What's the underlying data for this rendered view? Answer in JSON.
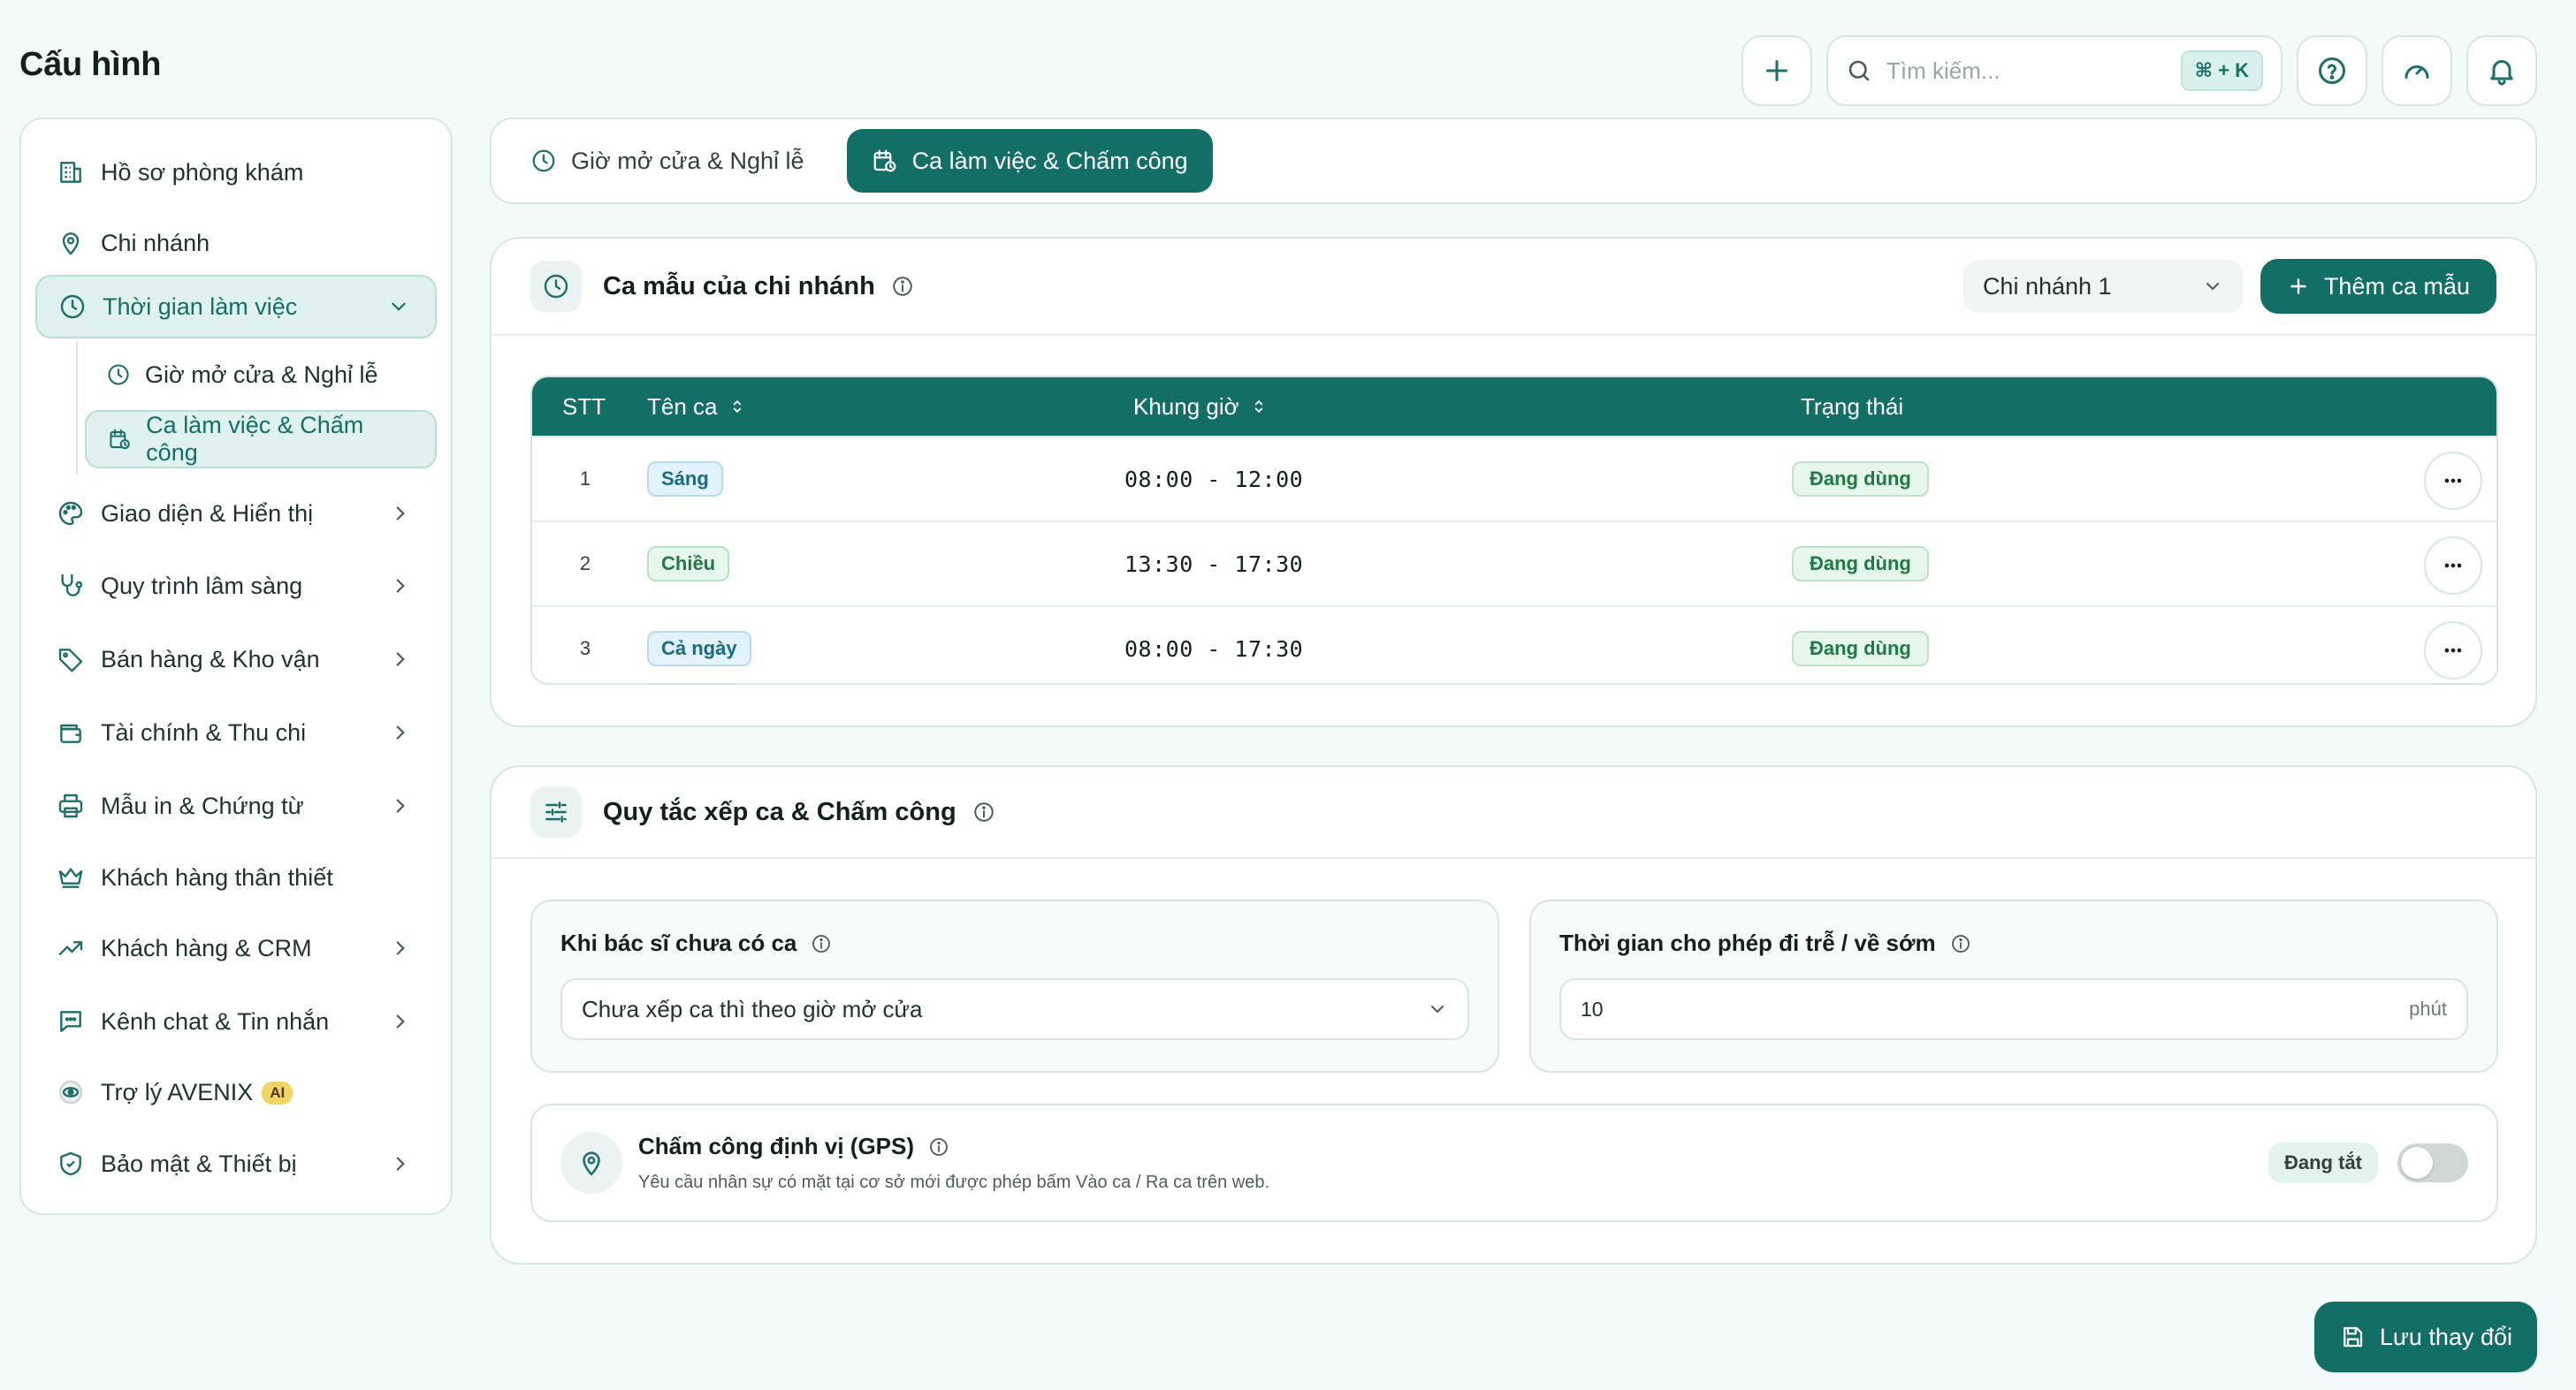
{
  "page": {
    "title": "Cấu hình"
  },
  "topbar": {
    "search_placeholder": "Tìm kiếm...",
    "shortcut": "⌘ + K"
  },
  "sidebar": {
    "items": [
      {
        "label": "Hồ sơ phòng khám",
        "icon": "building-icon"
      },
      {
        "label": "Chi nhánh",
        "icon": "map-pin-icon"
      },
      {
        "label": "Thời gian làm việc",
        "icon": "clock-icon"
      },
      {
        "label": "Giao diện & Hiển thị",
        "icon": "palette-icon"
      },
      {
        "label": "Quy trình lâm sàng",
        "icon": "stethoscope-icon"
      },
      {
        "label": "Bán hàng & Kho vận",
        "icon": "tag-icon"
      },
      {
        "label": "Tài chính & Thu chi",
        "icon": "wallet-icon"
      },
      {
        "label": "Mẫu in & Chứng từ",
        "icon": "printer-icon"
      },
      {
        "label": "Khách hàng thân thiết",
        "icon": "crown-icon"
      },
      {
        "label": "Khách hàng & CRM",
        "icon": "trending-up-icon"
      },
      {
        "label": "Kênh chat & Tin nhắn",
        "icon": "message-icon"
      },
      {
        "label": "Trợ lý AVENIX",
        "icon": "eye-icon",
        "badge": "AI"
      },
      {
        "label": "Bảo mật & Thiết bị",
        "icon": "shield-icon"
      }
    ],
    "subitems": [
      {
        "label": "Giờ mở cửa & Nghỉ lễ"
      },
      {
        "label": "Ca làm việc & Chấm công"
      }
    ]
  },
  "tabs": [
    {
      "label": "Giờ mở cửa & Nghỉ lễ"
    },
    {
      "label": "Ca làm việc & Chấm công"
    }
  ],
  "shift_templates": {
    "title": "Ca mẫu của chi nhánh",
    "branch": "Chi nhánh 1",
    "add_label": "Thêm ca mẫu",
    "columns": [
      "STT",
      "Tên ca",
      "Khung giờ",
      "Trạng thái"
    ],
    "rows": [
      {
        "stt": "1",
        "name": "Sáng",
        "time": "08:00 - 12:00",
        "status": "Đang dùng"
      },
      {
        "stt": "2",
        "name": "Chiều",
        "time": "13:30 - 17:30",
        "status": "Đang dùng"
      },
      {
        "stt": "3",
        "name": "Cả ngày",
        "time": "08:00 - 17:30",
        "status": "Đang dùng"
      }
    ]
  },
  "rules": {
    "title": "Quy tắc xếp ca & Chấm công",
    "no_shift": {
      "label": "Khi bác sĩ chưa có ca",
      "value": "Chưa xếp ca thì theo giờ mở cửa"
    },
    "tolerance": {
      "label": "Thời gian cho phép đi trễ / về sớm",
      "value": "10",
      "unit": "phút"
    },
    "gps": {
      "title": "Chấm công định vị (GPS)",
      "description": "Yêu cầu nhân sự có mặt tại cơ sở mới được phép bấm Vào ca / Ra ca trên web.",
      "status": "Đang tắt",
      "enabled": false
    }
  },
  "footer": {
    "save_label": "Lưu thay đổi"
  },
  "colors": {
    "primary": "#136f66",
    "background": "#f2fafa"
  }
}
